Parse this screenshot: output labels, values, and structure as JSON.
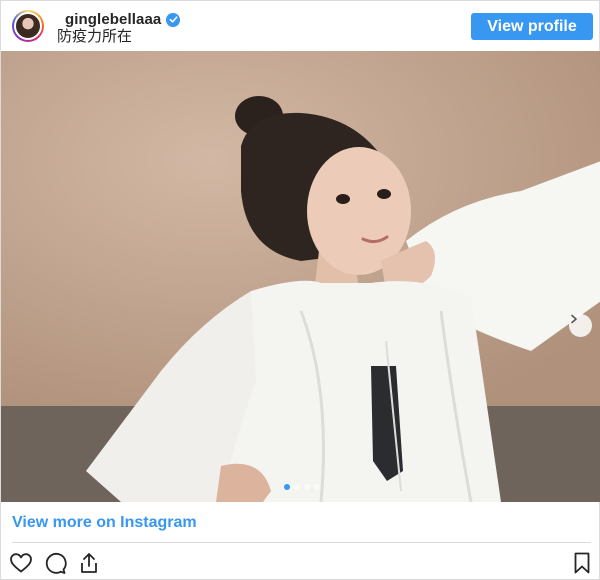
{
  "post": {
    "username": "ginglebellaaa",
    "caption": "防疫力所在",
    "view_profile_label": "View profile",
    "view_more_label": "View more on Instagram"
  },
  "carousel": {
    "slide_count": 4,
    "active_slide": 1
  },
  "icons": {
    "verified": "verified-badge-icon",
    "next": "chevron-right-icon",
    "like": "heart-icon",
    "comment": "comment-icon",
    "share": "share-icon",
    "save": "bookmark-icon"
  },
  "colors": {
    "accent": "#3897f0",
    "text": "#262626",
    "divider": "#dbdbdb"
  }
}
